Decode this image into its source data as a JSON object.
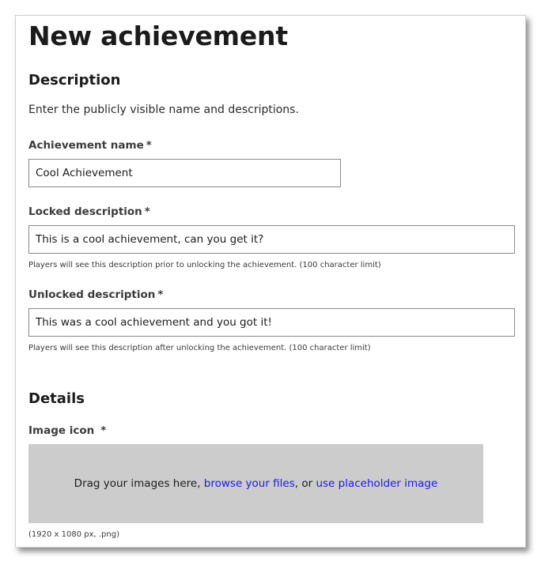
{
  "page": {
    "title": "New achievement"
  },
  "description_section": {
    "heading": "Description",
    "intro": "Enter the publicly visible name and descriptions."
  },
  "fields": {
    "achievement_name": {
      "label": "Achievement name",
      "required_marker": "*",
      "value": "Cool Achievement"
    },
    "locked_description": {
      "label": "Locked description",
      "required_marker": "*",
      "value": "This is a cool achievement, can you get it?",
      "help": "Players will see this description prior to unlocking the achievement. (100 character limit)"
    },
    "unlocked_description": {
      "label": "Unlocked description",
      "required_marker": "*",
      "value": "This was a cool achievement and you got it!",
      "help": "Players will see this description after unlocking the achievement. (100 character limit)"
    }
  },
  "details_section": {
    "heading": "Details",
    "image_icon": {
      "label": "Image icon",
      "required_marker": "*",
      "dropzone_text": "Drag your images here, ",
      "browse_link": "browse your files",
      "separator": ", or ",
      "placeholder_link": "use placeholder image",
      "hint": "(1920 x 1080 px, .png)"
    }
  },
  "colors": {
    "link": "#1a1ae6",
    "dropzone_bg": "#cccccc",
    "input_border": "#8a8a8a"
  }
}
